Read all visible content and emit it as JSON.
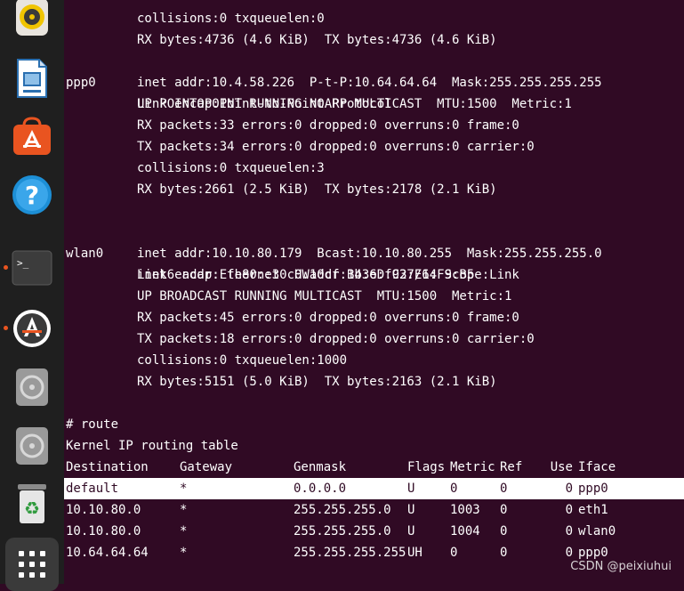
{
  "dock": {
    "items": [
      {
        "name": "rhythmbox-icon"
      },
      {
        "name": "libreoffice-impress-icon"
      },
      {
        "name": "ubuntu-software-icon"
      },
      {
        "name": "help-icon"
      },
      {
        "name": "terminal-icon"
      },
      {
        "name": "software-updater-icon"
      },
      {
        "name": "disc-icon"
      },
      {
        "name": "disc-icon-2"
      },
      {
        "name": "trash-icon"
      },
      {
        "name": "show-applications-icon"
      }
    ],
    "colors": {
      "background": "#1f1f1f",
      "running_dot": "#e95420",
      "orange": "#e95420"
    }
  },
  "terminal": {
    "colors": {
      "background": "#300a24",
      "text": "#ffffff"
    },
    "partial_top": "collisions:0 txqueuelen:0",
    "top_rx": "RX bytes:4736 (4.6 KiB)  TX bytes:4736 (4.6 KiB)",
    "ppp0": {
      "name": "ppp0",
      "lines": [
        "Link encap:Point-to-Point Protocol",
        "inet addr:10.4.58.226  P-t-P:10.64.64.64  Mask:255.255.255.255",
        "UP POINTOPOINT RUNNING NOARP MULTICAST  MTU:1500  Metric:1",
        "RX packets:33 errors:0 dropped:0 overruns:0 frame:0",
        "TX packets:34 errors:0 dropped:0 overruns:0 carrier:0",
        "collisions:0 txqueuelen:3",
        "RX bytes:2661 (2.5 KiB)  TX bytes:2178 (2.1 KiB)"
      ]
    },
    "wlan0": {
      "name": "wlan0",
      "lines": [
        "Link encap:Ethernet  HWaddr B4:6D:C2:E1:F9:B5",
        "inet addr:10.10.80.179  Bcast:10.10.80.255  Mask:255.255.255.0",
        "inet6 addr: fe80::30c0:10cf:1b3e:f937/64 Scope:Link",
        "UP BROADCAST RUNNING MULTICAST  MTU:1500  Metric:1",
        "RX packets:45 errors:0 dropped:0 overruns:0 frame:0",
        "TX packets:18 errors:0 dropped:0 overruns:0 carrier:0",
        "collisions:0 txqueuelen:1000",
        "RX bytes:5151 (5.0 KiB)  TX bytes:2163 (2.1 KiB)"
      ]
    },
    "route_cmd": "# route",
    "route_title": "Kernel IP routing table",
    "route_headers": {
      "destination": "Destination",
      "gateway": "Gateway",
      "genmask": "Genmask",
      "flags": "Flags",
      "metric": "Metric",
      "ref": "Ref",
      "use": "Use",
      "iface": "Iface"
    },
    "routes": [
      {
        "destination": "default",
        "gateway": "*",
        "genmask": "0.0.0.0",
        "flags": "U",
        "metric": "0",
        "ref": "0",
        "use": "0",
        "iface": "ppp0"
      },
      {
        "destination": "10.10.80.0",
        "gateway": "*",
        "genmask": "255.255.255.0",
        "flags": "U",
        "metric": "1003",
        "ref": "0",
        "use": "0",
        "iface": "eth1"
      },
      {
        "destination": "10.10.80.0",
        "gateway": "*",
        "genmask": "255.255.255.0",
        "flags": "U",
        "metric": "1004",
        "ref": "0",
        "use": "0",
        "iface": "wlan0"
      },
      {
        "destination": "10.64.64.64",
        "gateway": "*",
        "genmask": "255.255.255.255",
        "flags": "UH",
        "metric": "0",
        "ref": "0",
        "use": "0",
        "iface": "ppp0"
      }
    ],
    "prompt": "#"
  },
  "watermark": "CSDN @peixiuhui"
}
